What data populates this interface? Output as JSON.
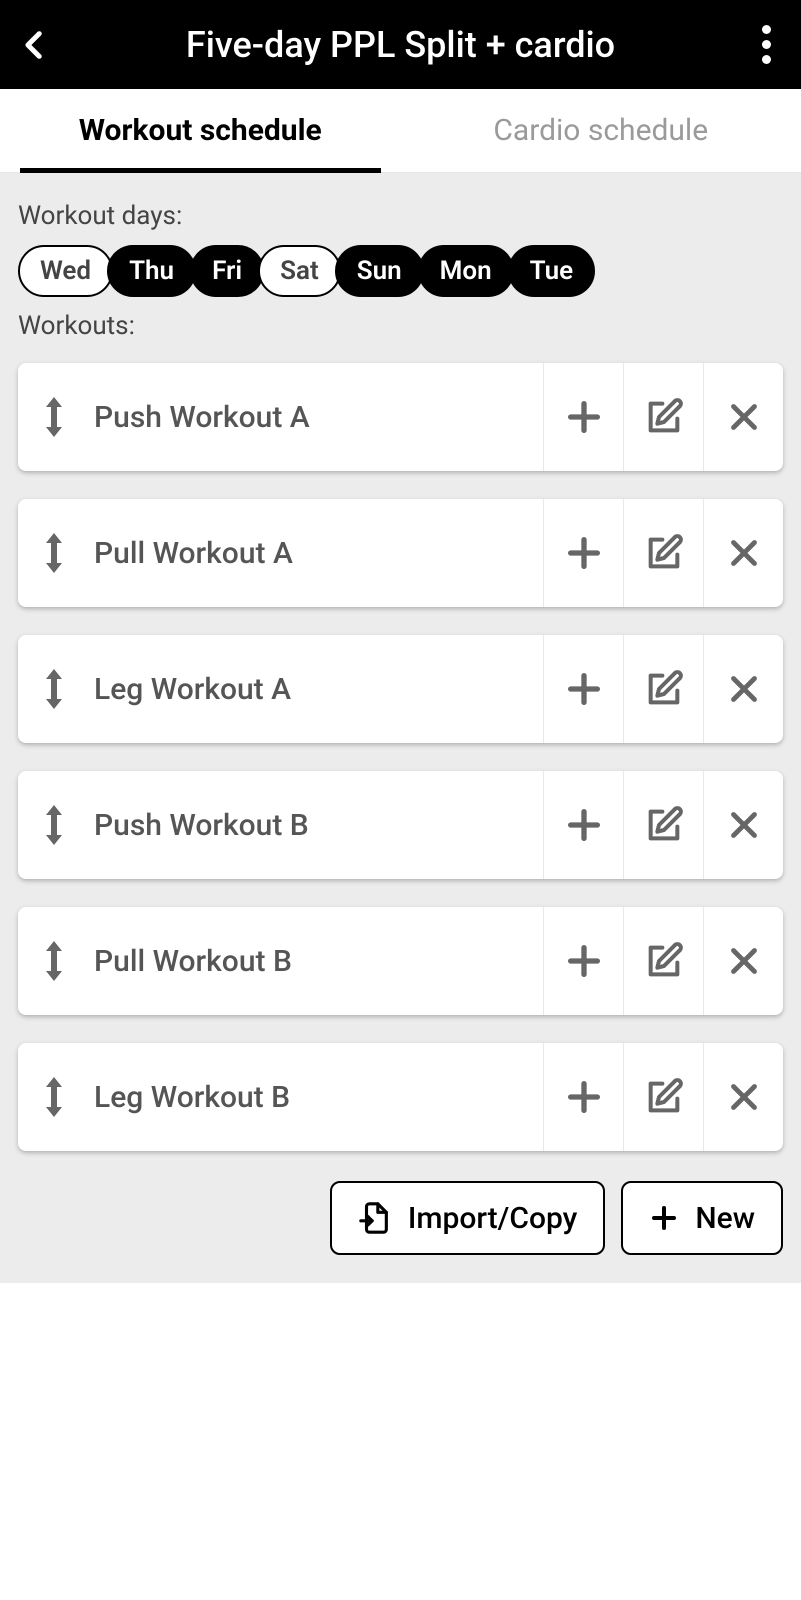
{
  "header": {
    "title": "Five-day PPL Split + cardio"
  },
  "tabs": [
    {
      "label": "Workout schedule",
      "active": true
    },
    {
      "label": "Cardio schedule",
      "active": false
    }
  ],
  "sections": {
    "days_label": "Workout days:",
    "workouts_label": "Workouts:"
  },
  "days": [
    {
      "label": "Wed",
      "selected": true
    },
    {
      "label": "Thu",
      "selected": false
    },
    {
      "label": "Fri",
      "selected": false
    },
    {
      "label": "Sat",
      "selected": true
    },
    {
      "label": "Sun",
      "selected": false
    },
    {
      "label": "Mon",
      "selected": false
    },
    {
      "label": "Tue",
      "selected": false
    }
  ],
  "workouts": [
    {
      "name": "Push Workout A"
    },
    {
      "name": "Pull Workout A"
    },
    {
      "name": "Leg Workout A"
    },
    {
      "name": "Push Workout B"
    },
    {
      "name": "Pull Workout B"
    },
    {
      "name": "Leg Workout B"
    }
  ],
  "buttons": {
    "import": "Import/Copy",
    "new": "New"
  }
}
